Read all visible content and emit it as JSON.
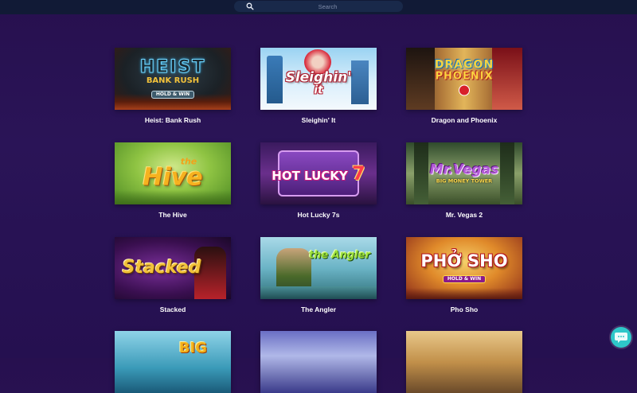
{
  "search": {
    "placeholder": "Search",
    "value": "",
    "icon": "search-icon"
  },
  "games": [
    {
      "title": "Heist: Bank Rush",
      "logo_main": "HEIST",
      "logo_sub": "BANK RUSH",
      "logo_badge": "HOLD & WIN"
    },
    {
      "title": "Sleighin' It",
      "logo_main": "Sleighin'",
      "logo_sub": "it"
    },
    {
      "title": "Dragon and Phoenix",
      "logo_main": "DRAGON",
      "logo_sub": "PHOENIX"
    },
    {
      "title": "The Hive",
      "logo_main": "Hive",
      "logo_sub": "the"
    },
    {
      "title": "Hot Lucky 7s",
      "logo_main": "HOT LUCKY",
      "logo_sub": "7"
    },
    {
      "title": "Mr. Vegas 2",
      "logo_main": "Mr.Vegas",
      "logo_sub": "BIG MONEY TOWER"
    },
    {
      "title": "Stacked",
      "logo_main": "Stacked"
    },
    {
      "title": "The Angler",
      "logo_main": "the Angler"
    },
    {
      "title": "Pho Sho",
      "logo_main": "PHỞ SHO",
      "logo_badge": "HOLD & WIN"
    },
    {
      "title": "",
      "logo_main": "BIG"
    },
    {
      "title": "",
      "logo_main": ""
    },
    {
      "title": "",
      "logo_main": ""
    }
  ],
  "chat": {
    "icon": "chat-bubble-icon"
  }
}
